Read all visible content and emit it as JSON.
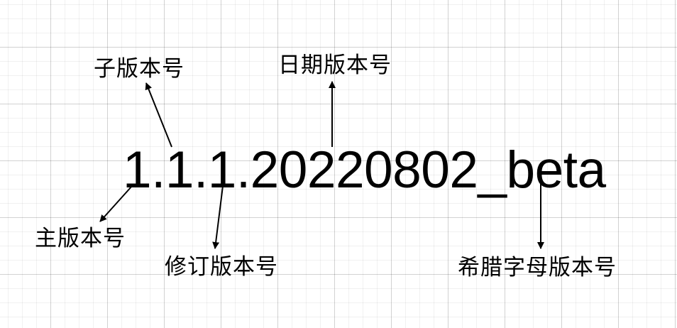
{
  "diagram": {
    "version_string": "1.1.1.20220802_beta",
    "labels": {
      "sub_version": "子版本号",
      "date_version": "日期版本号",
      "major_version": "主版本号",
      "patch_version": "修订版本号",
      "greek_version": "希腊字母版本号"
    }
  }
}
